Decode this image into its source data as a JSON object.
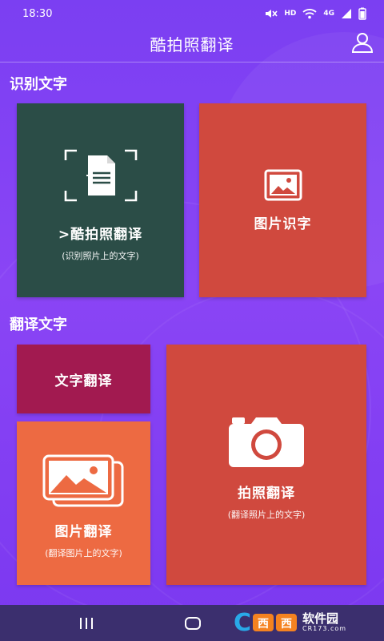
{
  "status_bar": {
    "time": "18:30",
    "network_hd": "HD",
    "network_4g": "4G"
  },
  "header": {
    "title": "酷拍照翻译"
  },
  "section_recognize": {
    "title": "识别文字",
    "tiles": {
      "cool": {
        "label": ">酷拍照翻译",
        "sub": "(识别照片上的文字)"
      },
      "picture": {
        "label": "图片识字"
      }
    }
  },
  "section_translate": {
    "title": "翻译文字",
    "tiles": {
      "text": {
        "label": "文字翻译"
      },
      "image": {
        "label": "图片翻译",
        "sub": "(翻译图片上的文字)"
      },
      "photo": {
        "label": "拍照翻译",
        "sub": "(翻译照片上的文字)"
      }
    }
  },
  "watermark": {
    "brand": "软件园",
    "site": "CR173.com"
  },
  "colors": {
    "background": "#7b3ff2",
    "tile_green": "#2b4d47",
    "tile_red": "#d0493e",
    "tile_magenta": "#a21a50",
    "tile_orange": "#ed6a42",
    "nav_bar": "#3b2f6e"
  },
  "icons": {
    "user": "user-icon",
    "scan_document": "scan-document-icon",
    "image": "image-icon",
    "image_stack": "image-stack-icon",
    "camera": "camera-icon",
    "recent": "recent-apps-icon",
    "home": "home-icon"
  }
}
